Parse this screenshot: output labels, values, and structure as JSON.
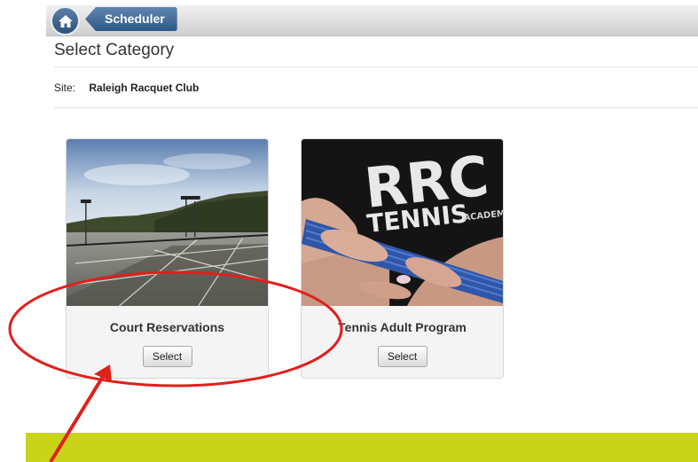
{
  "breadcrumb": {
    "scheduler_label": "Scheduler"
  },
  "page": {
    "title": "Select Category"
  },
  "site": {
    "label": "Site:",
    "value": "Raleigh Racquet Club"
  },
  "categories": [
    {
      "name": "Court Reservations",
      "button_label": "Select",
      "image": "tennis-courts-photo"
    },
    {
      "name": "Tennis Adult Program",
      "button_label": "Select",
      "image": "racquet-grip-photo"
    }
  ],
  "photo_text": {
    "line1": "RRC",
    "line2": "TENNIS",
    "line3": "ACADEMY"
  },
  "annotation": {
    "color": "#e0201b",
    "shapes": [
      "ellipse",
      "arrow"
    ]
  },
  "colors": {
    "accent": "#2f5884",
    "footer": "#c9d418"
  }
}
